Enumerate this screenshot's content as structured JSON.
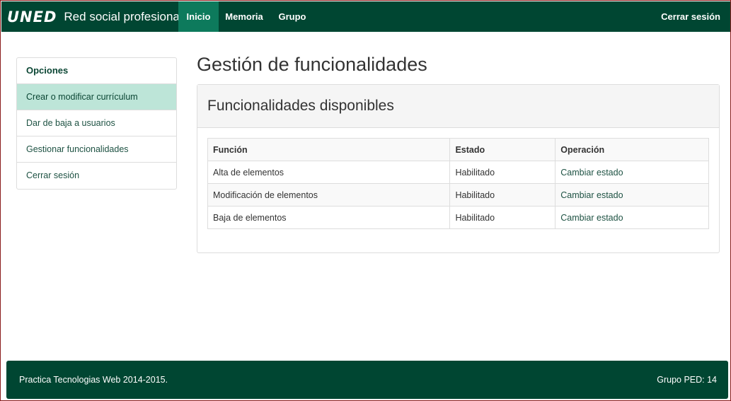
{
  "navbar": {
    "logo": "UNED",
    "title": "Red social profesional",
    "items": [
      {
        "label": "Inicio",
        "active": true
      },
      {
        "label": "Memoria",
        "active": false
      },
      {
        "label": "Grupo",
        "active": false
      }
    ],
    "logout": "Cerrar sesión"
  },
  "sidebar": {
    "heading": "Opciones",
    "items": [
      {
        "label": "Crear o modificar currículum",
        "active": true
      },
      {
        "label": "Dar de baja a usuarios",
        "active": false
      },
      {
        "label": "Gestionar funcionalidades",
        "active": false
      },
      {
        "label": "Cerrar sesión",
        "active": false
      }
    ]
  },
  "main": {
    "title": "Gestión de funcionalidades",
    "panel_title": "Funcionalidades disponibles",
    "table": {
      "headers": [
        "Función",
        "Estado",
        "Operación"
      ],
      "rows": [
        [
          "Alta de elementos",
          "Habilitado",
          "Cambiar estado"
        ],
        [
          "Modificación de elementos",
          "Habilitado",
          "Cambiar estado"
        ],
        [
          "Baja de elementos",
          "Habilitado",
          "Cambiar estado"
        ]
      ]
    }
  },
  "footer": {
    "left": "Practica Tecnologias Web 2014-2015.",
    "right": "Grupo PED: 14"
  },
  "colors": {
    "brand": "#004632",
    "active_nav": "#0d7a5c",
    "active_sidebar": "#bde5d8"
  }
}
